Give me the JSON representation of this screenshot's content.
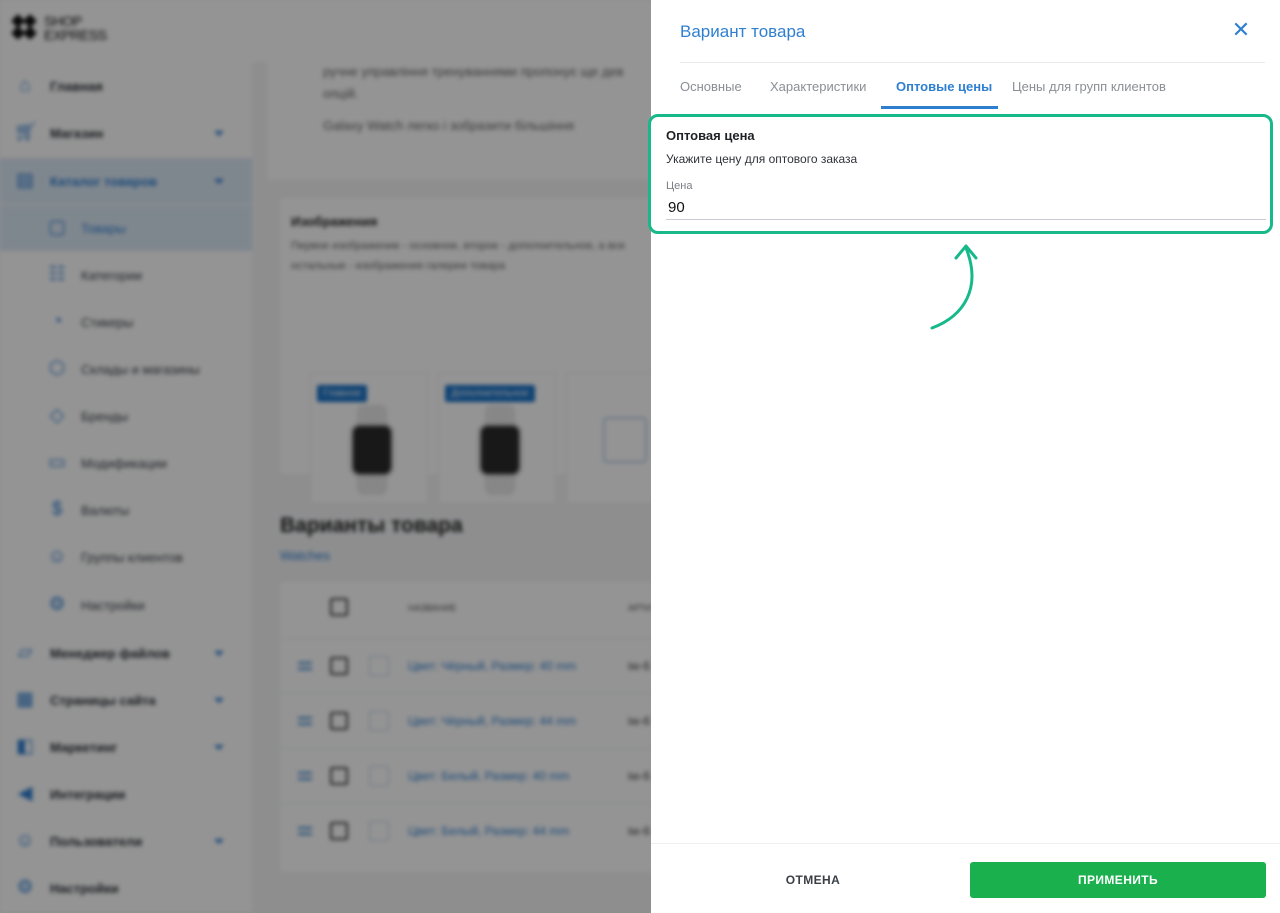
{
  "brand": {
    "logo_line1": "SHOP",
    "logo_line2": "EXPRESS"
  },
  "sidebar": {
    "items": [
      {
        "label": "Главная",
        "icon": "home-icon"
      },
      {
        "label": "Магазин",
        "icon": "cart-icon"
      },
      {
        "label": "Каталог товаров",
        "icon": "catalog-icon"
      },
      {
        "label": "Товары",
        "icon": "box-icon"
      },
      {
        "label": "Категории",
        "icon": "categories-icon"
      },
      {
        "label": "Стикеры",
        "icon": "sticker-icon"
      },
      {
        "label": "Склады и магазины",
        "icon": "warehouse-icon"
      },
      {
        "label": "Бренды",
        "icon": "tag-icon"
      },
      {
        "label": "Модификации",
        "icon": "modifications-icon"
      },
      {
        "label": "Валюты",
        "icon": "currency-icon"
      },
      {
        "label": "Группы клиентов",
        "icon": "users-group-icon"
      },
      {
        "label": "Настройки",
        "icon": "gear-icon"
      },
      {
        "label": "Менеджер файлов",
        "icon": "folder-icon"
      },
      {
        "label": "Страницы сайта",
        "icon": "pages-icon"
      },
      {
        "label": "Маркетинг",
        "icon": "marketing-icon"
      },
      {
        "label": "Интеграции",
        "icon": "megaphone-icon"
      },
      {
        "label": "Пользователи",
        "icon": "user-icon"
      },
      {
        "label": "Настройки",
        "icon": "gear-icon"
      }
    ]
  },
  "main": {
    "desc_line1": "ручне управління тренуваннями пропонує ще дев",
    "desc_line2": "опцій.",
    "desc_line3": "Galaxy Watch легко і зобразити більшіння",
    "images_title": "Изображения",
    "images_desc_1": "Первое изображение - основное, второе - дополнительное, а все",
    "images_desc_2": "остальные - изображения галереи товара",
    "badge_main": "Главное",
    "badge_additional": "Дополнительное",
    "variants_title": "Варианты товара",
    "variants_link": "Watches",
    "col_name": "НАЗВАНИЕ",
    "col_sku": "АРТИ",
    "rows": [
      {
        "name": "Цвет: Чёрный, Размер: 40 mm",
        "sku": "iw-6"
      },
      {
        "name": "Цвет: Чёрный, Размер: 44 mm",
        "sku": "iw-6"
      },
      {
        "name": "Цвет: Белый, Размер: 40 mm",
        "sku": "iw-6"
      },
      {
        "name": "Цвет: Белый, Размер: 44 mm",
        "sku": "iw-6"
      }
    ]
  },
  "drawer": {
    "title": "Вариант товара",
    "tabs": [
      "Основные",
      "Характеристики",
      "Оптовые цены",
      "Цены для групп клиентов"
    ],
    "active_tab_index": 2,
    "field_title": "Оптовая цена",
    "field_desc": "Укажите цену для оптового заказа",
    "price_label": "Цена",
    "price_value": "90",
    "cancel_label": "ОТМЕНА",
    "apply_label": "ПРИМЕНИТЬ"
  },
  "colors": {
    "accent": "#2f7fd1",
    "highlight": "#17b98a",
    "apply": "#1ab04e"
  }
}
